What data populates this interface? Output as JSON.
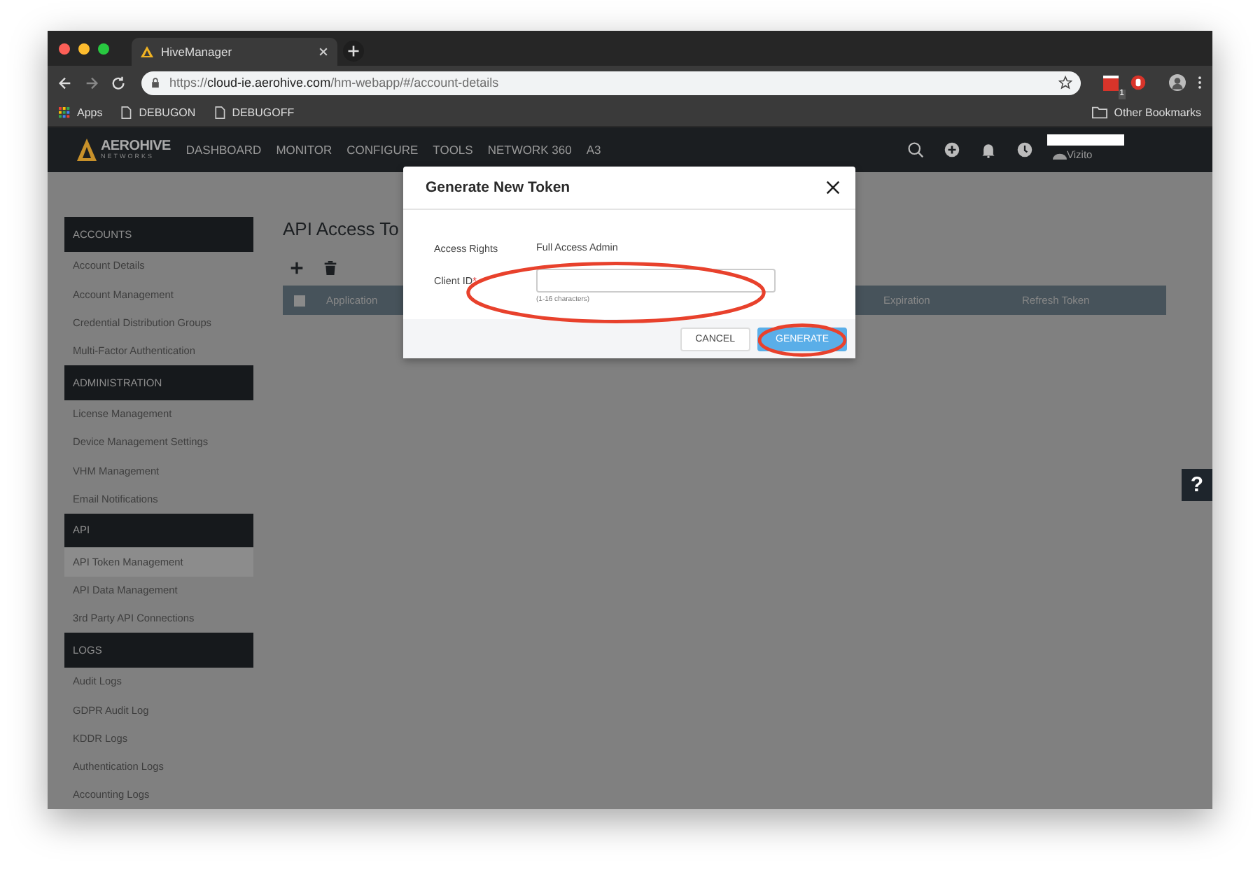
{
  "browser": {
    "tab_title": "HiveManager",
    "url": {
      "prefix": "https://",
      "host": "cloud-ie.aerohive.com",
      "path": "/hm-webapp/#/account-details"
    },
    "extension_badge": "1",
    "bookmarks": [
      {
        "label": "Apps",
        "kind": "apps"
      },
      {
        "label": "DEBUGON",
        "kind": "page"
      },
      {
        "label": "DEBUGOFF",
        "kind": "page"
      }
    ],
    "other_bookmarks": "Other Bookmarks"
  },
  "app_nav": {
    "logo": {
      "name": "AEROHIVE",
      "sub": "NETWORKS"
    },
    "items": [
      "DASHBOARD",
      "MONITOR",
      "CONFIGURE",
      "TOOLS",
      "NETWORK 360",
      "A3"
    ],
    "user_name": "Vizito"
  },
  "sidebar": {
    "sections": [
      {
        "title": "ACCOUNTS",
        "items": [
          {
            "label": "Account Details",
            "selected": false
          },
          {
            "label": "Account Management",
            "selected": false
          },
          {
            "label": "Credential Distribution Groups",
            "selected": false
          },
          {
            "label": "Multi-Factor Authentication",
            "selected": false
          }
        ]
      },
      {
        "title": "ADMINISTRATION",
        "items": [
          {
            "label": "License Management",
            "selected": false
          },
          {
            "label": "Device Management Settings",
            "selected": false
          },
          {
            "label": "VHM Management",
            "selected": false
          },
          {
            "label": "Email Notifications",
            "selected": false
          }
        ]
      },
      {
        "title": "API",
        "items": [
          {
            "label": "API Token Management",
            "selected": true
          },
          {
            "label": "API Data Management",
            "selected": false
          },
          {
            "label": "3rd Party API Connections",
            "selected": false
          }
        ]
      },
      {
        "title": "LOGS",
        "items": [
          {
            "label": "Audit Logs",
            "selected": false
          },
          {
            "label": "GDPR Audit Log",
            "selected": false
          },
          {
            "label": "KDDR Logs",
            "selected": false
          },
          {
            "label": "Authentication Logs",
            "selected": false
          },
          {
            "label": "Accounting Logs",
            "selected": false
          }
        ]
      }
    ]
  },
  "page": {
    "title": "API Access To",
    "table": {
      "select_all_checked": false,
      "columns": [
        "Application",
        "Expiration",
        "Refresh Token"
      ]
    }
  },
  "help_button": "?",
  "dialog": {
    "title": "Generate New Token",
    "fields": [
      {
        "kind": "static",
        "label": "Access Rights",
        "value": "Full Access Admin"
      },
      {
        "kind": "input",
        "label": "Client ID",
        "required_mark": "*",
        "hint": "(1-16 characters)"
      }
    ],
    "buttons": [
      {
        "label": "CANCEL",
        "kind": "secondary"
      },
      {
        "label": "GENERATE",
        "kind": "primary"
      }
    ]
  }
}
